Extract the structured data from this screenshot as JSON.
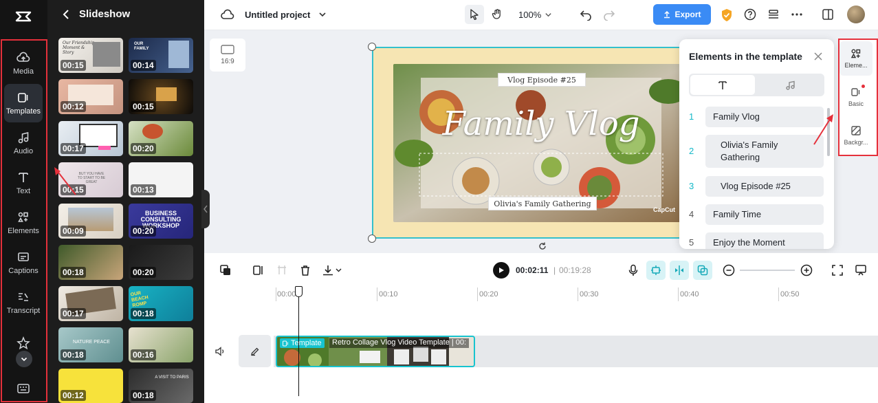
{
  "rail": {
    "items": [
      {
        "label": "Media",
        "icon": "cloud-upload-icon"
      },
      {
        "label": "Templates",
        "icon": "templates-icon"
      },
      {
        "label": "Audio",
        "icon": "music-note-icon"
      },
      {
        "label": "Text",
        "icon": "text-icon"
      },
      {
        "label": "Elements",
        "icon": "elements-icon"
      },
      {
        "label": "Captions",
        "icon": "captions-icon"
      },
      {
        "label": "Transcript",
        "icon": "transcript-icon"
      }
    ],
    "active": "Templates"
  },
  "panel": {
    "title": "Slideshow",
    "thumbnails": [
      {
        "duration": "00:15",
        "caption": "Our Friendship Moment & Story"
      },
      {
        "duration": "00:14",
        "caption": "OUR FAMILY"
      },
      {
        "duration": "00:12",
        "caption": ""
      },
      {
        "duration": "00:15",
        "caption": ""
      },
      {
        "duration": "00:17",
        "caption": ""
      },
      {
        "duration": "00:20",
        "caption": ""
      },
      {
        "duration": "00:15",
        "caption": "BUT YOU HAVE TO START TO BE GREAT"
      },
      {
        "duration": "00:13",
        "caption": ""
      },
      {
        "duration": "00:09",
        "caption": ""
      },
      {
        "duration": "00:20",
        "caption": "BUSINESS CONSULTING WORKSHOP"
      },
      {
        "duration": "00:18",
        "caption": ""
      },
      {
        "duration": "00:20",
        "caption": ""
      },
      {
        "duration": "00:17",
        "caption": ""
      },
      {
        "duration": "00:18",
        "caption": "OUR BEACH ROMP"
      },
      {
        "duration": "00:18",
        "caption": "NATURE PEACE"
      },
      {
        "duration": "00:16",
        "caption": ""
      },
      {
        "duration": "00:12",
        "caption": ""
      },
      {
        "duration": "00:18",
        "caption": "A VISIT TO PARIS"
      }
    ]
  },
  "topbar": {
    "project_name": "Untitled project",
    "zoom": "100%",
    "export_label": "Export"
  },
  "canvas": {
    "aspect_ratio": "16:9",
    "episode_text": "Vlog Episode #25",
    "title_script": "Family Vlog",
    "subtitle": "Olivia's Family Gathering",
    "watermark": "CapCut"
  },
  "elements_panel": {
    "title": "Elements in the template",
    "items": [
      {
        "num": "1",
        "text": "Family Vlog"
      },
      {
        "num": "2",
        "text": "Olivia's Family Gathering"
      },
      {
        "num": "3",
        "text": "Vlog Episode #25"
      },
      {
        "num": "4",
        "text": "Family Time"
      },
      {
        "num": "5",
        "text": "Enjoy the Moment"
      }
    ]
  },
  "side_tabs": [
    {
      "label": "Eleme...",
      "icon": "elements-icon"
    },
    {
      "label": "Basic",
      "icon": "basic-icon"
    },
    {
      "label": "Backgr...",
      "icon": "background-icon"
    }
  ],
  "toolbar": {
    "current_time": "00:02:11",
    "total_time": "00:19:28"
  },
  "timeline": {
    "ticks": [
      "00:00",
      "00:10",
      "00:20",
      "00:30",
      "00:40",
      "00:50"
    ],
    "clip_tag": "Template",
    "clip_title": "Retro Collage Vlog Video Template | 00:"
  },
  "colors": {
    "accent": "#3a8bf5",
    "highlight": "#e5303b",
    "selection": "#33c0cc"
  }
}
